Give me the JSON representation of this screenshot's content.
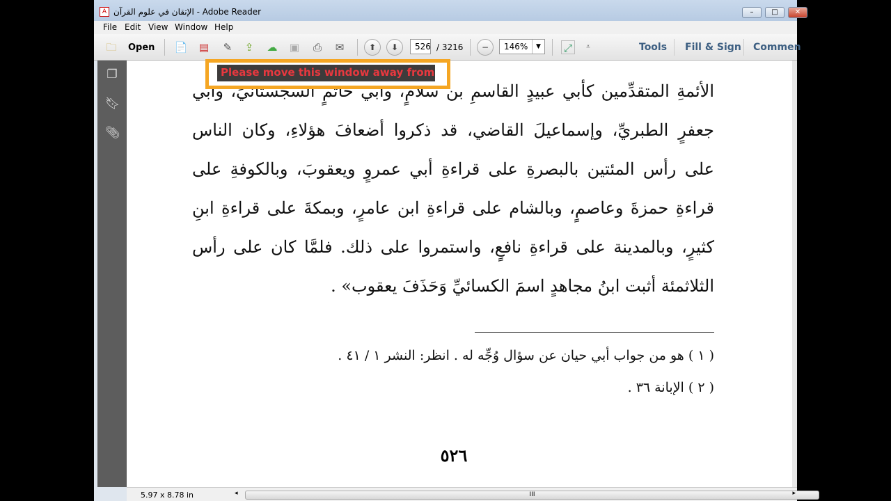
{
  "window": {
    "title": "الإتقان في علوم القرآن - Adobe Reader",
    "controls": [
      "minimize",
      "maximize",
      "close"
    ]
  },
  "menu": [
    "File",
    "Edit",
    "View",
    "Window",
    "Help"
  ],
  "toolbar": {
    "open_label": "Open",
    "page_current": "526",
    "page_total": "/ 3216",
    "zoom": "146%",
    "tools": "Tools",
    "fill_sign": "Fill & Sign",
    "comment": "Commen"
  },
  "overlay": {
    "text": "Please move this window away from"
  },
  "document": {
    "lines": [
      "الأئمةِ المتقدِّمين كأبي عبيدٍ القاسمِ بن سلامٍ، وأبي حاتمٍ السجستانيِّ، وأبي",
      "جعفرٍ الطبريِّ، وإسماعيلَ القاضي، قد ذكروا أضعافَ هؤلاءِ، وكان الناس",
      "على رأس المئتين بالبصرةِ على قراءةِ أبي عمروٍ ويعقوبَ، وبالكوفةِ على",
      "قراءةِ حمزةَ وعاصمٍ، وبالشام على قراءةِ ابن عامرٍ، وبمكةَ على قراءةِ ابنِ",
      "كثيرٍ، وبالمدينة على قراءةِ نافعٍ، واستمروا على ذلك. فلمَّا كان على رأس",
      "الثلاثمئة أثبت ابنُ مجاهدٍ اسمَ الكسائيِّ وَحَذَفَ يعقوب» ."
    ],
    "footnotes": [
      "( ١ ) هو من جواب أبي حيان عن سؤال وُجِّه له . انظر: النشر ١ / ٤١ .",
      "( ٢ ) الإبانة ٣٦ ."
    ],
    "page_number": "٥٢٦"
  },
  "status": {
    "page_size": "5.97 x 8.78 in",
    "scroll_grip": "III"
  }
}
